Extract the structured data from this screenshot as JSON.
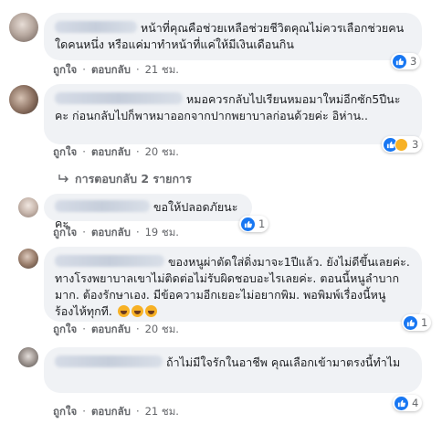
{
  "comments": [
    {
      "text": "หน้าที่คุณคือช่วยเหลือช่วยชีวิตคุณไม่ควรเลือกช่วยคนใดคนหนึ่ง หรือแค่มาทำหน้าที่แค่ให้มีเงินเดือนกิน",
      "like_label": "ถูกใจ",
      "reply_label": "ตอบกลับ",
      "time": "21 ชม.",
      "reaction_count": "3"
    },
    {
      "text": "หมอควรกลับไปเรียนหมอมาใหม่อีกซัก5ปีนะคะ ก่อนกลับไปก็พาหมาออกจากปากพยาบาลก่อนด้วยค่ะ อิห่าน..",
      "like_label": "ถูกใจ",
      "reply_label": "ตอบกลับ",
      "time": "20 ชม.",
      "reaction_count": "3"
    },
    {
      "text": "ขอให้ปลอดภัยนะคะ",
      "like_label": "ถูกใจ",
      "reply_label": "ตอบกลับ",
      "time": "19 ชม.",
      "reaction_count": "1"
    },
    {
      "text": "ของหนูผ่าตัดใส่ดิ่งมาจะ1ปีแล้ว. ยังไม่ดีขึ้นเลยค่ะ. ทางโรงพยาบาลเขาไม่ติดต่อไม่รับผิดชอบอะไรเลยค่ะ. ตอนนี้หนูลำบากมาก. ต้องรักษาเอง. มีข้อความอีกเยอะไม่อยากพิม. พอพิมพ์เรื่องนี้หนูร้องไห้ทุกที.",
      "like_label": "ถูกใจ",
      "reply_label": "ตอบกลับ",
      "time": "20 ชม.",
      "reaction_count": "1"
    },
    {
      "text": "ถ้าไม่มีใจรักในอาชีพ คุณเลือกเข้ามาตรงนี้ทำไม",
      "like_label": "ถูกใจ",
      "reply_label": "ตอบกลับ",
      "time": "21 ชม.",
      "reaction_count": "4"
    }
  ],
  "replies_link": "การตอบกลับ 2 รายการ",
  "separator": "·"
}
